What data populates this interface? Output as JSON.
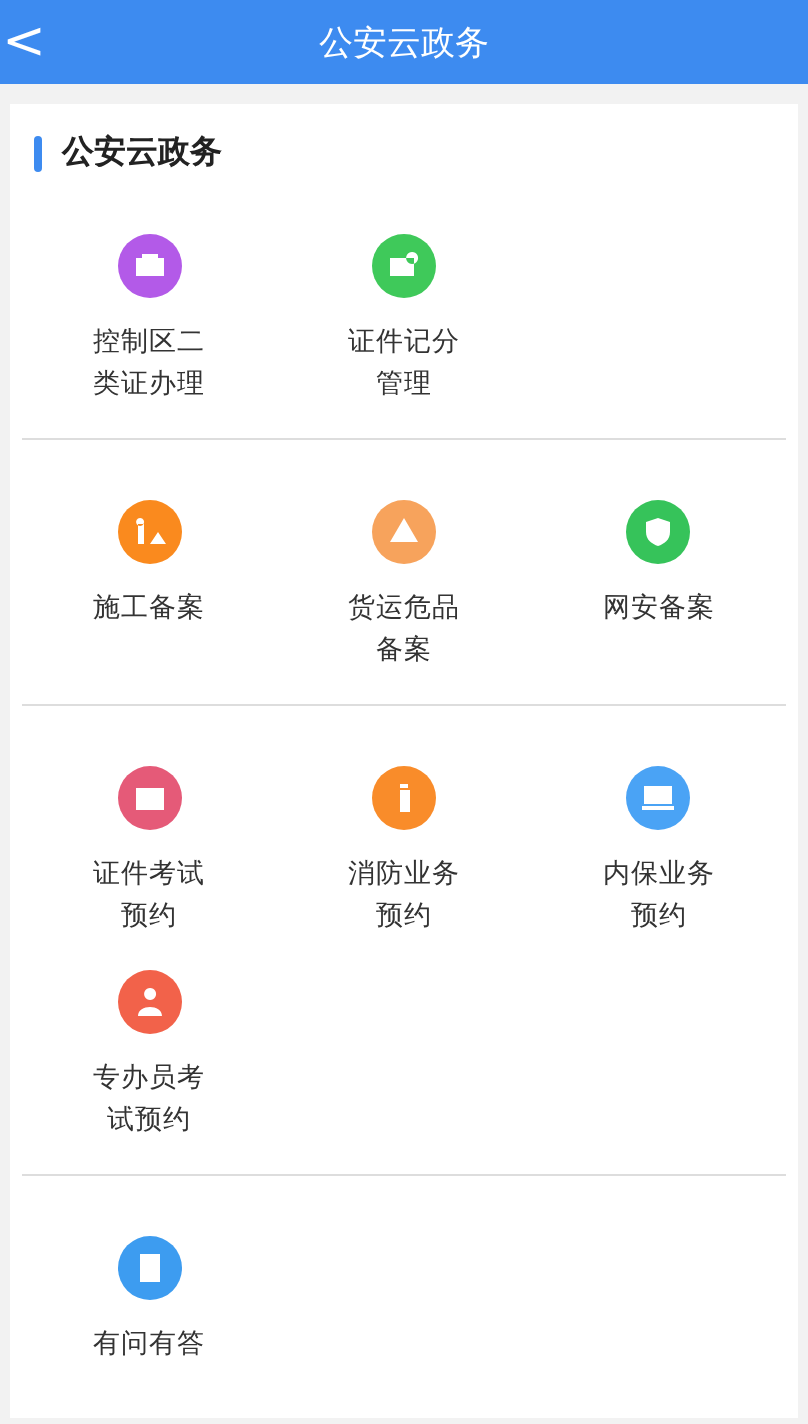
{
  "header": {
    "back": "<",
    "title": "公安云政务"
  },
  "section_title": "公安云政务",
  "groups": [
    {
      "items": [
        {
          "label": "控制区二类证办理",
          "color": "#b35ae8"
        },
        {
          "label": "证件记分管理",
          "color": "#3fc95a"
        }
      ]
    },
    {
      "items": [
        {
          "label": "施工备案",
          "color": "#fa8a1e"
        },
        {
          "label": "货运危品备案",
          "color": "#f7a35c"
        },
        {
          "label": "网安备案",
          "color": "#36c35a"
        }
      ]
    },
    {
      "items": [
        {
          "label": "证件考试预约",
          "color": "#e55a78"
        },
        {
          "label": "消防业务预约",
          "color": "#f98c2a"
        },
        {
          "label": "内保业务预约",
          "color": "#4aa3f5"
        },
        {
          "label": "专办员考试预约",
          "color": "#f2624a"
        }
      ]
    },
    {
      "items": [
        {
          "label": "有问有答",
          "color": "#3d9cf0"
        }
      ]
    }
  ]
}
